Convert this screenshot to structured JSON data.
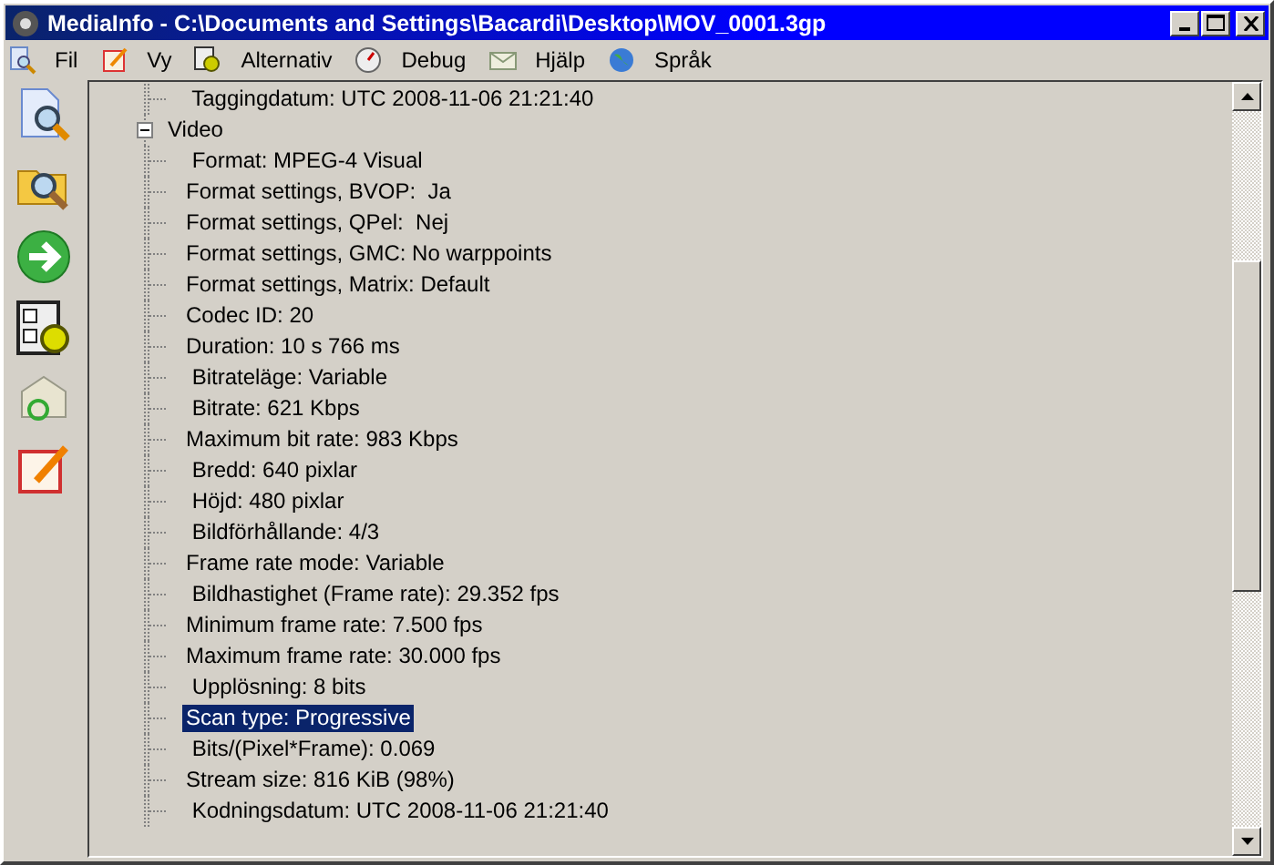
{
  "window": {
    "title": "MediaInfo - C:\\Documents and Settings\\Bacardi\\Desktop\\MOV_0001.3gp"
  },
  "menu": [
    {
      "label": "Fil"
    },
    {
      "label": "Vy"
    },
    {
      "label": "Alternativ"
    },
    {
      "label": "Debug"
    },
    {
      "label": "Hjälp"
    },
    {
      "label": "Språk"
    }
  ],
  "tree": {
    "scrolled_children": [
      {
        "label": " Taggingdatum: UTC 2008-11-06 21:21:40",
        "selected": false
      }
    ],
    "nodes": [
      {
        "label": "Video",
        "expanded": true,
        "selected": false,
        "children": [
          {
            "label": " Format: MPEG-4 Visual",
            "selected": false
          },
          {
            "label": "Format settings, BVOP:  Ja",
            "selected": false
          },
          {
            "label": "Format settings, QPel:  Nej",
            "selected": false
          },
          {
            "label": "Format settings, GMC: No warppoints",
            "selected": false
          },
          {
            "label": "Format settings, Matrix: Default",
            "selected": false
          },
          {
            "label": "Codec ID: 20",
            "selected": false
          },
          {
            "label": "Duration: 10 s 766 ms",
            "selected": false
          },
          {
            "label": " Bitrateläge: Variable",
            "selected": false
          },
          {
            "label": " Bitrate: 621 Kbps",
            "selected": false
          },
          {
            "label": "Maximum bit rate: 983 Kbps",
            "selected": false
          },
          {
            "label": " Bredd: 640 pixlar",
            "selected": false
          },
          {
            "label": " Höjd: 480 pixlar",
            "selected": false
          },
          {
            "label": " Bildförhållande: 4/3",
            "selected": false
          },
          {
            "label": "Frame rate mode: Variable",
            "selected": false
          },
          {
            "label": " Bildhastighet (Frame rate): 29.352 fps",
            "selected": false
          },
          {
            "label": "Minimum frame rate: 7.500 fps",
            "selected": false
          },
          {
            "label": "Maximum frame rate: 30.000 fps",
            "selected": false
          },
          {
            "label": " Upplösning: 8 bits",
            "selected": false
          },
          {
            "label": "Scan type: Progressive",
            "selected": true
          },
          {
            "label": " Bits/(Pixel*Frame): 0.069",
            "selected": false
          },
          {
            "label": "Stream size: 816 KiB (98%)",
            "selected": false
          },
          {
            "label": " Kodningsdatum: UTC 2008-11-06 21:21:40",
            "selected": false
          }
        ]
      }
    ]
  }
}
